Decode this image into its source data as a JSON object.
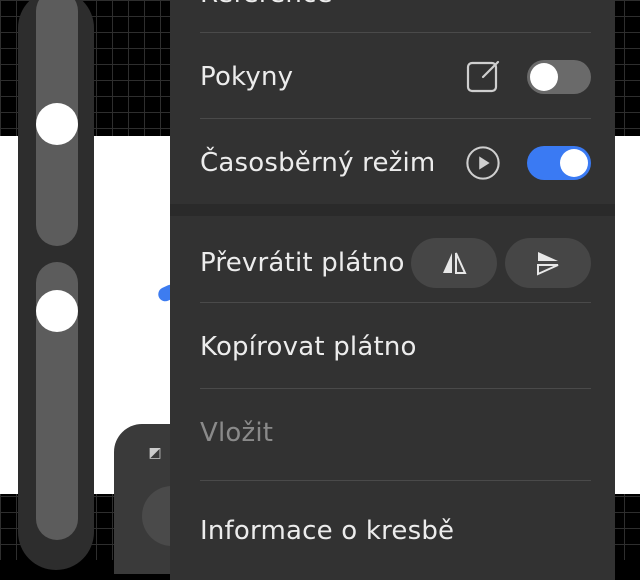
{
  "menu": {
    "partial_top_label": "Reference",
    "guides": {
      "label": "Pokyny",
      "icon": "edit-square-icon",
      "enabled": false
    },
    "timelapse": {
      "label": "Časosběrný režim",
      "icon": "play-circle-icon",
      "enabled": true
    },
    "flip_canvas": {
      "label": "Převrátit plátno",
      "horizontal_icon": "flip-horizontal-icon",
      "vertical_icon": "flip-vertical-icon"
    },
    "copy_canvas": {
      "label": "Kopírovat plátno"
    },
    "paste": {
      "label": "Vložit",
      "disabled": true
    },
    "drawing_info": {
      "label": "Informace o kresbě"
    }
  },
  "colors": {
    "toggle_on": "#3a7af3",
    "toggle_off": "#6a6a6a",
    "menu_background": "#323232"
  },
  "sliders": {
    "brush_size_level": 0.55,
    "brush_opacity_level": 0.9
  }
}
